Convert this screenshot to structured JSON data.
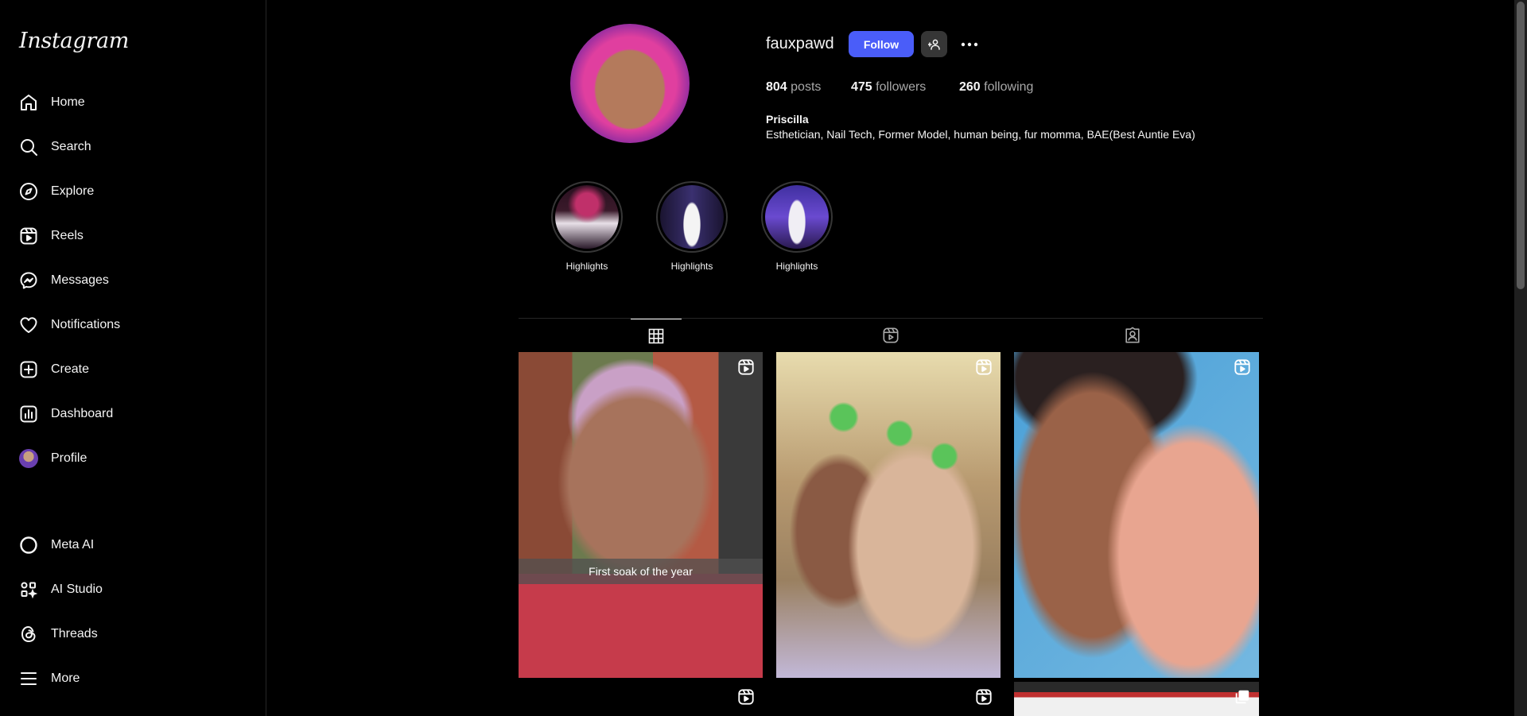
{
  "app": {
    "logo": "Instagram"
  },
  "sidebar": {
    "items": [
      {
        "label": "Home",
        "icon": "home-icon"
      },
      {
        "label": "Search",
        "icon": "search-icon"
      },
      {
        "label": "Explore",
        "icon": "compass-icon"
      },
      {
        "label": "Reels",
        "icon": "reels-icon"
      },
      {
        "label": "Messages",
        "icon": "messenger-icon"
      },
      {
        "label": "Notifications",
        "icon": "heart-icon"
      },
      {
        "label": "Create",
        "icon": "plus-square-icon"
      },
      {
        "label": "Dashboard",
        "icon": "dashboard-icon"
      },
      {
        "label": "Profile",
        "icon": "avatar"
      }
    ],
    "bottom_items": [
      {
        "label": "Meta AI",
        "icon": "meta-ai-icon"
      },
      {
        "label": "AI Studio",
        "icon": "ai-studio-icon"
      },
      {
        "label": "Threads",
        "icon": "threads-icon"
      },
      {
        "label": "More",
        "icon": "menu-icon"
      }
    ]
  },
  "profile": {
    "username": "fauxpawd",
    "follow_label": "Follow",
    "stats": {
      "posts": {
        "count": "804",
        "label": "posts"
      },
      "followers": {
        "count": "475",
        "label": "followers"
      },
      "following": {
        "count": "260",
        "label": "following"
      }
    },
    "full_name": "Priscilla",
    "bio": "Esthetician, Nail Tech, Former Model, human being, fur momma, BAE(Best Auntie Eva)"
  },
  "highlights": [
    {
      "label": "Highlights"
    },
    {
      "label": "Highlights"
    },
    {
      "label": "Highlights"
    }
  ],
  "tabs": [
    {
      "name": "posts",
      "icon": "grid-icon",
      "active": true
    },
    {
      "name": "reels",
      "icon": "reels-icon",
      "active": false
    },
    {
      "name": "tagged",
      "icon": "tagged-icon",
      "active": false
    }
  ],
  "posts": [
    {
      "type": "reel",
      "caption": "First soak of the year"
    },
    {
      "type": "reel",
      "caption": ""
    },
    {
      "type": "reel",
      "caption": ""
    },
    {
      "type": "reel",
      "caption": ""
    },
    {
      "type": "reel",
      "caption": ""
    },
    {
      "type": "carousel",
      "caption": ""
    }
  ],
  "colors": {
    "background": "#000000",
    "follow_button": "#4a5df9",
    "text": "#f5f5f5",
    "muted": "#a8a8a8"
  }
}
